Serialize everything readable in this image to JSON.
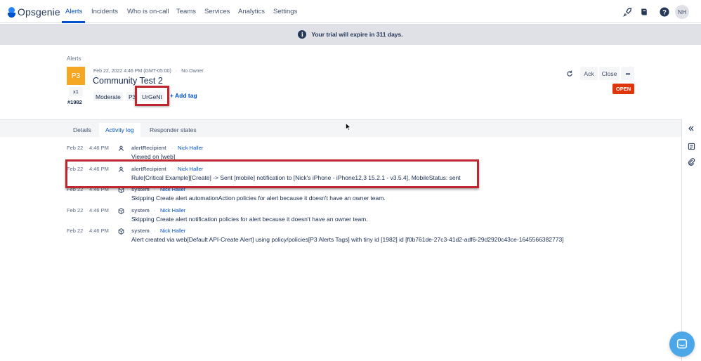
{
  "app": {
    "name": "Opsgenie"
  },
  "nav": {
    "items": [
      {
        "label": "Alerts",
        "active": true
      },
      {
        "label": "Incidents"
      },
      {
        "label": "Who is on-call"
      },
      {
        "label": "Teams"
      },
      {
        "label": "Services"
      },
      {
        "label": "Analytics"
      },
      {
        "label": "Settings"
      }
    ],
    "user_initials": "NH"
  },
  "banner": {
    "text": "Your trial will expire in 311 days.",
    "icon": "info-icon"
  },
  "alert": {
    "breadcrumb": "Alerts",
    "priority": "P3",
    "count": "x1",
    "tiny_id": "#1982",
    "created": "Feb 22, 2022 4:46 PM (GMT-05:00)",
    "owner": "No Owner",
    "title": "Community Test 2",
    "tags": [
      "Moderate",
      "P3",
      "UrGeNt"
    ],
    "add_tag_label": "+ Add tag",
    "actions": {
      "ack": "Ack",
      "close": "Close",
      "more": "•••"
    },
    "status": "OPEN"
  },
  "tabs": [
    {
      "label": "Details"
    },
    {
      "label": "Activity log",
      "active": true
    },
    {
      "label": "Responder states"
    }
  ],
  "activity_log": [
    {
      "date": "Feb 22",
      "time": "4:46 PM",
      "actor": "alertRecipient",
      "user": "Nick Haller",
      "message": "Viewed on [web]",
      "icon": "recipient-icon"
    },
    {
      "date": "Feb 22",
      "time": "4:46 PM",
      "actor": "alertRecipient",
      "user": "Nick Haller",
      "message": "Rule[Critical Example][Create] -> Sent [mobile] notification to [Nick's iPhone - iPhone12,3 15.2.1 - v3.5.4], MobileStatus: sent",
      "icon": "recipient-icon"
    },
    {
      "date": "Feb 22",
      "time": "4:46 PM",
      "actor": "system",
      "user": "Nick Haller",
      "message": "Skipping Create alert automationAction policies for alert because it doesn't have an owner team.",
      "icon": "system-icon"
    },
    {
      "date": "Feb 22",
      "time": "4:46 PM",
      "actor": "system",
      "user": "Nick Haller",
      "message": "Skipping Create alert notification policies for alert because it doesn't have an owner team.",
      "icon": "system-icon"
    },
    {
      "date": "Feb 22",
      "time": "4:46 PM",
      "actor": "system",
      "user": "Nick Haller",
      "message": "Alert created via web[Default API-Create Alert] using policy/policies[P3 Alerts Tags] with tiny id [1982] id [f0b761de-27c3-41d2-adf6-29d2920c43ce-1645566382773]",
      "icon": "system-icon"
    }
  ],
  "colors": {
    "brand": "#0052cc",
    "priority_p3": "#f5a623",
    "status_open": "#de350b",
    "highlight": "#c0262d"
  }
}
